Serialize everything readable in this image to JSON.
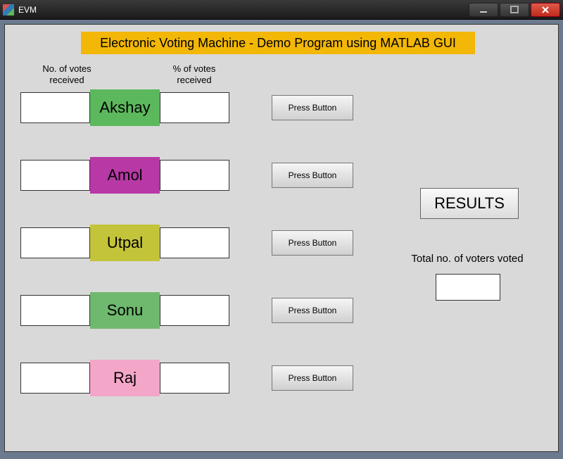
{
  "window": {
    "title": "EVM"
  },
  "header": {
    "banner": "Electronic Voting Machine - Demo Program using MATLAB GUI"
  },
  "columns": {
    "votes_label": "No. of votes received",
    "percent_label": "% of votes received"
  },
  "candidates": [
    {
      "name": "Akshay",
      "votes": "",
      "percent": "",
      "button_label": "Press Button",
      "color": "#5cb85c"
    },
    {
      "name": "Amol",
      "votes": "",
      "percent": "",
      "button_label": "Press Button",
      "color": "#b838a6"
    },
    {
      "name": "Utpal",
      "votes": "",
      "percent": "",
      "button_label": "Press Button",
      "color": "#c4c43a"
    },
    {
      "name": "Sonu",
      "votes": "",
      "percent": "",
      "button_label": "Press Button",
      "color": "#6fb96f"
    },
    {
      "name": "Raj",
      "votes": "",
      "percent": "",
      "button_label": "Press Button",
      "color": "#f3a6c8"
    }
  ],
  "results": {
    "button_label": "RESULTS",
    "total_label": "Total no. of voters voted",
    "total_value": ""
  }
}
